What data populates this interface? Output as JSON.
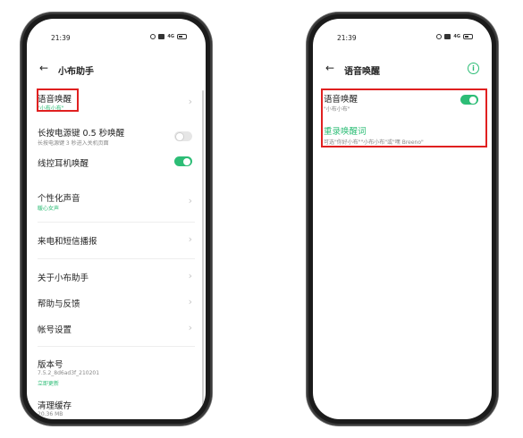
{
  "left": {
    "status": {
      "time": "21:39",
      "signal": "4G"
    },
    "nav": {
      "back": "←",
      "title": "小布助手"
    },
    "items": [
      {
        "label": "语音唤醒",
        "sub": "\"小布小布\""
      },
      {
        "label": "长按电源键 0.5 秒唤醒",
        "sub": "长按电源键 3 秒进入关机页面",
        "toggle": "off"
      },
      {
        "label": "线控耳机唤醒",
        "toggle": "on"
      },
      {
        "label": "个性化声音",
        "sub": "暖心女声"
      },
      {
        "label": "来电和短信播报"
      },
      {
        "label": "关于小布助手"
      },
      {
        "label": "帮助与反馈"
      },
      {
        "label": "帐号设置"
      },
      {
        "label": "版本号",
        "sub": "7.5.2_8d6ad3f_210201",
        "sub2": "立即更新"
      },
      {
        "label": "清理缓存",
        "sub": "20.36 MB"
      }
    ]
  },
  "right": {
    "status": {
      "time": "21:39",
      "signal": "4G"
    },
    "nav": {
      "back": "←",
      "title": "语音唤醒",
      "info": "i"
    },
    "wake": {
      "label": "语音唤醒",
      "sub": "\"小布小布\"",
      "toggle": "on"
    },
    "record": {
      "label": "重录唤醒词",
      "sub": "可选\"你好小布\"\"小布小布\"或\"嘿 Breeno\""
    }
  },
  "colors": {
    "accent": "#2dbd76",
    "highlight_border": "#e02020"
  },
  "chevron": "›"
}
